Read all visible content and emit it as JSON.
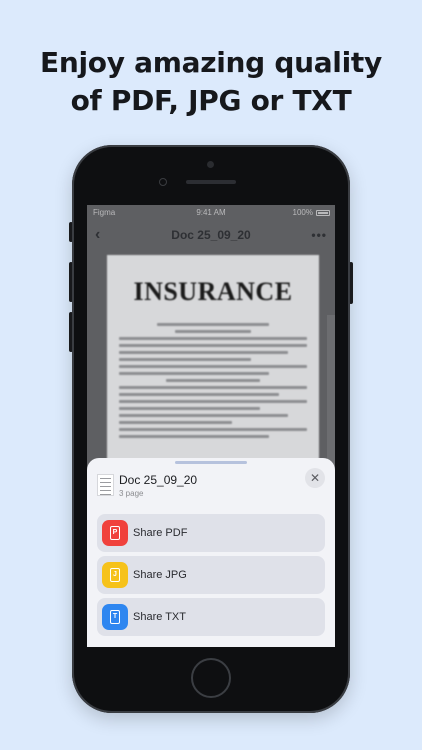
{
  "headline": {
    "line1": "Enjoy amazing quality",
    "line2": "of PDF, JPG or TXT"
  },
  "statusbar": {
    "carrier": "Figma",
    "time": "9:41 AM",
    "battery": "100%"
  },
  "navbar": {
    "title": "Doc 25_09_20",
    "back_icon": "chevron-left-icon",
    "more_icon": "ellipsis-icon"
  },
  "document_preview": {
    "heading": "INSURANCE"
  },
  "sheet": {
    "title": "Doc 25_09_20",
    "subtitle": "3 page",
    "close_icon": "close-icon",
    "actions": [
      {
        "label": "Share PDF",
        "icon": "pdf-file-icon",
        "icon_letter": "P",
        "color": "#f0413c"
      },
      {
        "label": "Share JPG",
        "icon": "jpg-file-icon",
        "icon_letter": "J",
        "color": "#f6c21a"
      },
      {
        "label": "Share TXT",
        "icon": "txt-file-icon",
        "icon_letter": "T",
        "color": "#2e86f0"
      }
    ]
  },
  "colors": {
    "background": "#dceafc",
    "phone_body": "#0e0f11",
    "sheet_bg": "#f2f3f7",
    "button_bg": "#dfe1e9"
  }
}
